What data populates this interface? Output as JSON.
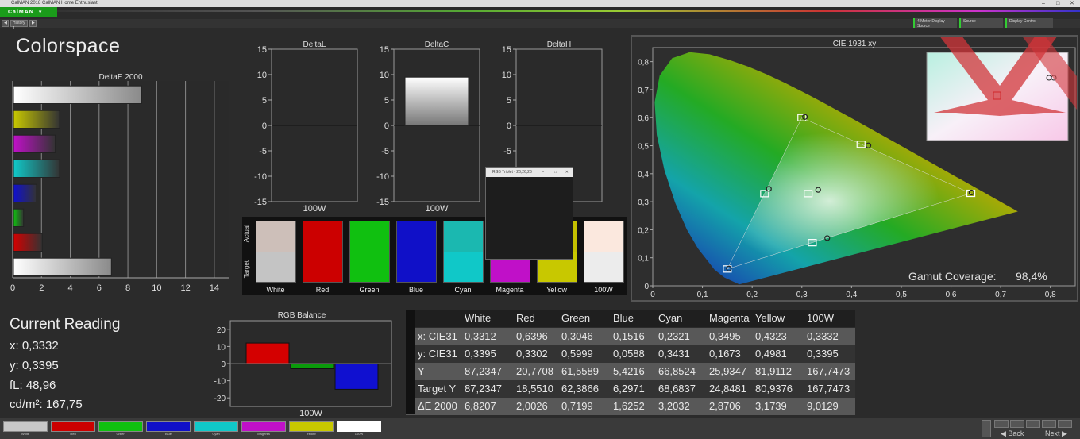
{
  "window": {
    "title": "CalMAN 2018 CalMAN Home Enthusiast",
    "app_logo": "CalMAN",
    "history_tab": "History 1",
    "right_tabs": [
      "4 Meter Display Source",
      "Source",
      "Display Control"
    ]
  },
  "colors": {
    "accent": "#1a9c1a",
    "white": "#ffffff",
    "red": "#d40000",
    "green": "#10c010",
    "blue": "#1010d0",
    "cyan": "#10c8c8",
    "magenta": "#c010c8",
    "yellow": "#c8c800",
    "overlay_x": "#d2353a"
  },
  "page": {
    "title": "Colorspace"
  },
  "current_reading": {
    "title": "Current Reading",
    "x": "x: 0,3332",
    "y": "y: 0,3395",
    "fL": "fL: 48,96",
    "cd": "cd/m²: 167,75"
  },
  "chart_data": [
    {
      "type": "bar",
      "orientation": "horizontal",
      "title": "DeltaE 2000",
      "categories": [
        "White",
        "Yellow",
        "Magenta",
        "Cyan",
        "Blue",
        "Green",
        "Red",
        "100W"
      ],
      "values": [
        8.9,
        3.2,
        2.9,
        3.2,
        1.6,
        0.7,
        2.0,
        6.8
      ],
      "xlim": [
        0,
        15
      ],
      "ticks": [
        "0",
        "2",
        "4",
        "6",
        "8",
        "10",
        "12",
        "14"
      ]
    },
    {
      "type": "bar",
      "title": "DeltaL",
      "categories": [
        "100W"
      ],
      "values": [
        0
      ],
      "ylim": [
        -15,
        15
      ],
      "ticks": [
        "15",
        "10",
        "5",
        "0",
        "-5",
        "-10",
        "-15"
      ]
    },
    {
      "type": "bar",
      "title": "DeltaC",
      "categories": [
        "100W"
      ],
      "values": [
        9.5
      ],
      "ylim": [
        -15,
        15
      ],
      "ticks": [
        "15",
        "10",
        "5",
        "0",
        "-5",
        "-10",
        "-15"
      ]
    },
    {
      "type": "bar",
      "title": "DeltaH",
      "categories": [
        "100W"
      ],
      "values": [
        0
      ],
      "ylim": [
        -15,
        15
      ],
      "ticks": [
        "15",
        "10",
        "5",
        "0",
        "-5",
        "-10",
        "-15"
      ]
    },
    {
      "type": "bar",
      "title": "RGB Balance",
      "categories": [
        "100W"
      ],
      "series": [
        {
          "values": [
            12
          ],
          "color": "#d40000"
        },
        {
          "values": [
            -3
          ],
          "color": "#0a9a0a"
        },
        {
          "values": [
            -15
          ],
          "color": "#1010d0"
        }
      ],
      "ylim": [
        -25,
        25
      ],
      "ticks": [
        "20",
        "10",
        "0",
        "-10",
        "-20"
      ]
    },
    {
      "type": "scatter",
      "title": "CIE 1931 xy",
      "xlim": [
        0,
        0.85
      ],
      "ylim": [
        0,
        0.85
      ],
      "xticks": [
        "0",
        "0,1",
        "0,2",
        "0,3",
        "0,4",
        "0,5",
        "0,6",
        "0,7",
        "0,8"
      ],
      "yticks": [
        "0",
        "0,1",
        "0,2",
        "0,3",
        "0,4",
        "0,5",
        "0,6",
        "0,7",
        "0,8"
      ],
      "targets": [
        {
          "name": "Red",
          "x": 0.64,
          "y": 0.33
        },
        {
          "name": "Green",
          "x": 0.3,
          "y": 0.6
        },
        {
          "name": "Blue",
          "x": 0.15,
          "y": 0.06
        },
        {
          "name": "Cyan",
          "x": 0.225,
          "y": 0.329
        },
        {
          "name": "Magenta",
          "x": 0.321,
          "y": 0.154
        },
        {
          "name": "Yellow",
          "x": 0.419,
          "y": 0.505
        },
        {
          "name": "White",
          "x": 0.3127,
          "y": 0.329
        }
      ],
      "measured": [
        {
          "name": "Red",
          "x": 0.6396,
          "y": 0.3302
        },
        {
          "name": "Green",
          "x": 0.3046,
          "y": 0.5999
        },
        {
          "name": "Blue",
          "x": 0.1516,
          "y": 0.0588
        },
        {
          "name": "Cyan",
          "x": 0.2321,
          "y": 0.3431
        },
        {
          "name": "Magenta",
          "x": 0.3495,
          "y": 0.1673
        },
        {
          "name": "Yellow",
          "x": 0.4323,
          "y": 0.4981
        },
        {
          "name": "White",
          "x": 0.3312,
          "y": 0.3395
        }
      ],
      "gamut_coverage_label": "Gamut Coverage:",
      "gamut_coverage_value": "98,4%"
    }
  ],
  "swatches": {
    "row_labels": [
      "Actual",
      "Target"
    ],
    "items": [
      {
        "label": "White",
        "actual": "#cdbfb9",
        "target": "#c4c4c4"
      },
      {
        "label": "Red",
        "actual": "#cc0000",
        "target": "#cc0000"
      },
      {
        "label": "Green",
        "actual": "#10c010",
        "target": "#10c010"
      },
      {
        "label": "Blue",
        "actual": "#1010c8",
        "target": "#1010c8"
      },
      {
        "label": "Cyan",
        "actual": "#1bb8b0",
        "target": "#10c8c8"
      },
      {
        "label": "Magenta",
        "actual": "#b010b8",
        "target": "#c010c8"
      },
      {
        "label": "Yellow",
        "actual": "#c4c000",
        "target": "#c8c800"
      },
      {
        "label": "100W",
        "actual": "#fbe8de",
        "target": "#ececec"
      }
    ]
  },
  "popup": {
    "title": "RGB Triplet - 26,26,26"
  },
  "table": {
    "headers": [
      "",
      "White",
      "Red",
      "Green",
      "Blue",
      "Cyan",
      "Magenta",
      "Yellow",
      "100W"
    ],
    "rows": [
      [
        "x: CIE31",
        "0,3312",
        "0,6396",
        "0,3046",
        "0,1516",
        "0,2321",
        "0,3495",
        "0,4323",
        "0,3332"
      ],
      [
        "y: CIE31",
        "0,3395",
        "0,3302",
        "0,5999",
        "0,0588",
        "0,3431",
        "0,1673",
        "0,4981",
        "0,3395"
      ],
      [
        "Y",
        "87,2347",
        "20,7708",
        "61,5589",
        "5,4216",
        "66,8524",
        "25,9347",
        "81,9112",
        "167,7473"
      ],
      [
        "Target Y",
        "87,2347",
        "18,5510",
        "62,3866",
        "6,2971",
        "68,6837",
        "24,8481",
        "80,9376",
        "167,7473"
      ],
      [
        "ΔE 2000",
        "6,8207",
        "2,0026",
        "0,7199",
        "1,6252",
        "3,2032",
        "2,8706",
        "3,1739",
        "9,0129"
      ]
    ]
  },
  "bottom_swatches": [
    {
      "label": "White",
      "color": "#c8c8c8"
    },
    {
      "label": "Red",
      "color": "#cc0000"
    },
    {
      "label": "Green",
      "color": "#10c010"
    },
    {
      "label": "Blue",
      "color": "#1010c8"
    },
    {
      "label": "Cyan",
      "color": "#10c8c8"
    },
    {
      "label": "Magenta",
      "color": "#c010c8"
    },
    {
      "label": "Yellow",
      "color": "#c8c800"
    },
    {
      "label": "100W",
      "color": "#ffffff"
    }
  ],
  "nav": {
    "back": "Back",
    "next": "Next"
  }
}
